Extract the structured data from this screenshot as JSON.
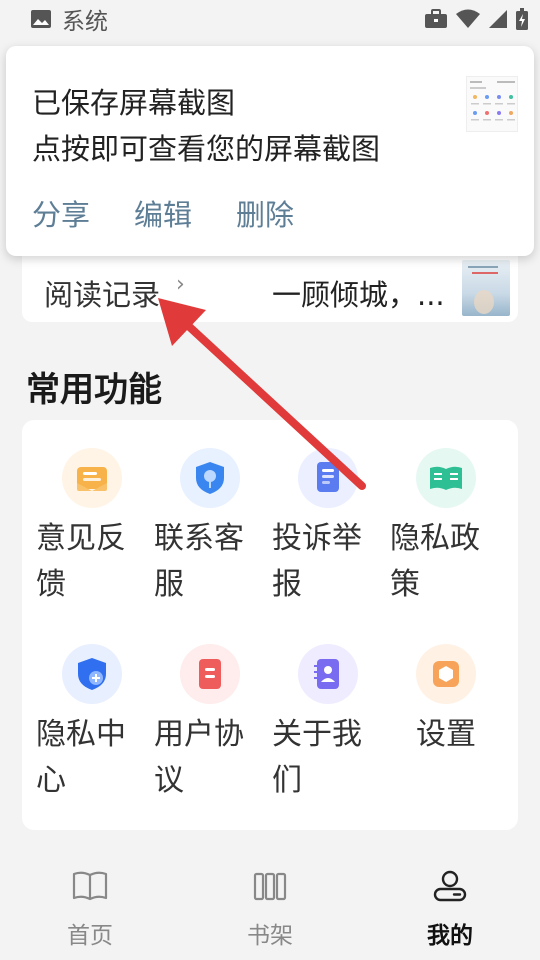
{
  "status_bar": {
    "app_name": "系统",
    "icons": [
      "image-icon",
      "briefcase-icon",
      "wifi-icon",
      "signal-icon",
      "battery-icon"
    ]
  },
  "notification": {
    "title": "已保存屏幕截图",
    "subtitle": "点按即可查看您的屏幕截图",
    "actions": [
      "分享",
      "编辑",
      "删除"
    ]
  },
  "reading": {
    "label": "阅读记录",
    "chevron": "›",
    "book_title": "一顾倾城，..."
  },
  "section": {
    "title": "常用功能"
  },
  "functions": [
    {
      "label": "意见反馈",
      "icon": "feedback-envelope-icon",
      "color": "#f7b24a"
    },
    {
      "label": "联系客服",
      "icon": "customer-service-shield-icon",
      "color": "#3a86f0"
    },
    {
      "label": "投诉举报",
      "icon": "report-document-icon",
      "color": "#5a7cf0"
    },
    {
      "label": "隐私政策",
      "icon": "privacy-book-icon",
      "color": "#2fbf95"
    },
    {
      "label": "隐私中心",
      "icon": "privacy-shield-plus-icon",
      "color": "#2f6ff0"
    },
    {
      "label": "用户协议",
      "icon": "agreement-document-icon",
      "color": "#ef5c5c"
    },
    {
      "label": "关于我们",
      "icon": "about-contact-icon",
      "color": "#7a6cf0"
    },
    {
      "label": "设置",
      "icon": "settings-hexagon-icon",
      "color": "#f7a45a"
    }
  ],
  "nav": {
    "items": [
      {
        "label": "首页",
        "icon": "book-open-icon",
        "active": false
      },
      {
        "label": "书架",
        "icon": "bookshelf-icon",
        "active": false
      },
      {
        "label": "我的",
        "icon": "profile-icon",
        "active": true
      }
    ]
  },
  "colors": {
    "accent_action": "#5e7e96",
    "arrow": "#e03a3a",
    "background": "#f3f3f3"
  }
}
